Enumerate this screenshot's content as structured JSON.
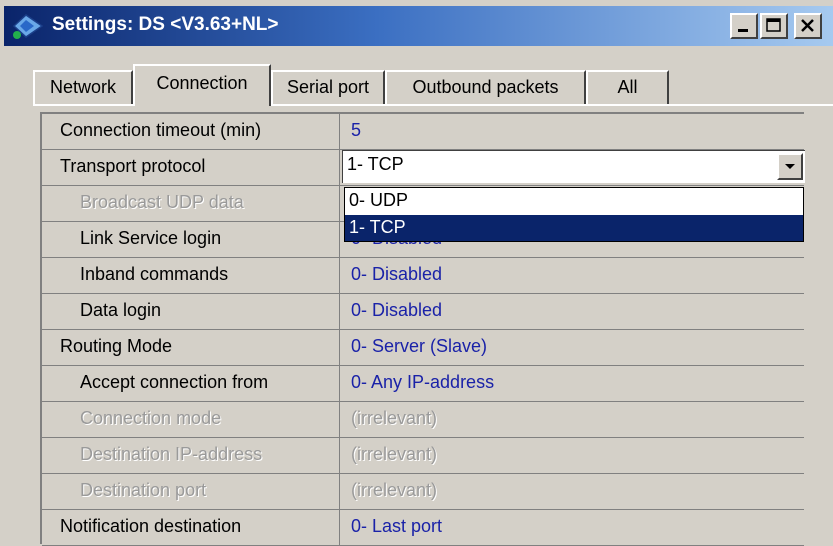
{
  "window": {
    "title": "Settings: DS <V3.63+NL>",
    "controls": {
      "minimize": "_",
      "maximize": "□",
      "close": "×"
    }
  },
  "tabs": [
    {
      "label": "Network",
      "active": false
    },
    {
      "label": "Connection",
      "active": true
    },
    {
      "label": "Serial port",
      "active": false
    },
    {
      "label": "Outbound packets",
      "active": false
    },
    {
      "label": "All",
      "active": false
    }
  ],
  "grid": {
    "rows": [
      {
        "name": "Connection timeout (min)",
        "value": "5",
        "level": 0,
        "disabled": false
      },
      {
        "name": "Transport protocol",
        "value": "1- TCP",
        "level": 0,
        "disabled": false
      },
      {
        "name": "Broadcast UDP data",
        "value": "",
        "level": 1,
        "disabled": true
      },
      {
        "name": "Link Service login",
        "value": "0- Disabled",
        "level": 1,
        "disabled": false
      },
      {
        "name": "Inband commands",
        "value": "0- Disabled",
        "level": 1,
        "disabled": false
      },
      {
        "name": "Data login",
        "value": "0- Disabled",
        "level": 1,
        "disabled": false
      },
      {
        "name": "Routing Mode",
        "value": "0- Server (Slave)",
        "level": 0,
        "disabled": false
      },
      {
        "name": "Accept connection from",
        "value": "0- Any IP-address",
        "level": 1,
        "disabled": false
      },
      {
        "name": "Connection mode",
        "value": "(irrelevant)",
        "level": 1,
        "disabled": true
      },
      {
        "name": "Destination IP-address",
        "value": "(irrelevant)",
        "level": 1,
        "disabled": true
      },
      {
        "name": "Destination port",
        "value": "(irrelevant)",
        "level": 1,
        "disabled": true
      },
      {
        "name": "Notification destination",
        "value": "0- Last port",
        "level": 0,
        "disabled": false
      }
    ]
  },
  "transport_combo": {
    "value": "1- TCP",
    "options": [
      {
        "label": "0- UDP",
        "selected": false
      },
      {
        "label": "1- TCP",
        "selected": true
      }
    ]
  },
  "colors": {
    "value_text": "#1a22a8",
    "selection": "#0a246a",
    "disabled_text": "#9a9a9a"
  }
}
